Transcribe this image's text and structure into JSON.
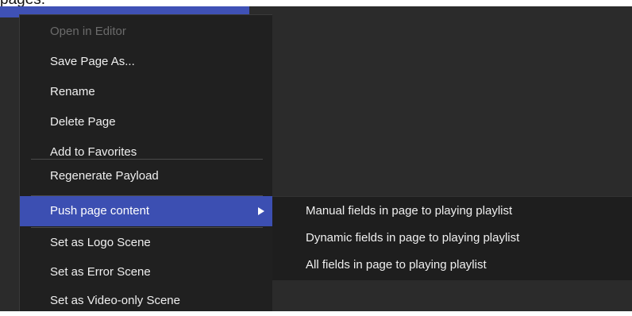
{
  "caption": {
    "text": "pages."
  },
  "context_menu": {
    "items": [
      {
        "label": "Open in Editor",
        "disabled": true
      },
      {
        "label": "Save Page As..."
      },
      {
        "label": "Rename"
      },
      {
        "label": "Delete Page"
      },
      {
        "label": "Add to Favorites"
      },
      {
        "label": "Regenerate Payload"
      },
      {
        "label": "Push page content",
        "has_submenu": true,
        "highlighted": true
      },
      {
        "label": "Set as Logo Scene"
      },
      {
        "label": "Set as Error Scene"
      },
      {
        "label": "Set as Video-only Scene"
      }
    ]
  },
  "submenu": {
    "items": [
      {
        "label": "Manual fields in page to playing playlist"
      },
      {
        "label": "Dynamic fields in page to playing playlist"
      },
      {
        "label": "All fields in page to playing playlist"
      }
    ]
  },
  "colors": {
    "canvas": "#2b2b2b",
    "menu_background": "#202020",
    "highlight": "#3c4fb2",
    "text": "#efefef",
    "disabled_text": "#6b6b6b"
  },
  "icons": {
    "submenu_indicator": "triangle-right-icon"
  }
}
